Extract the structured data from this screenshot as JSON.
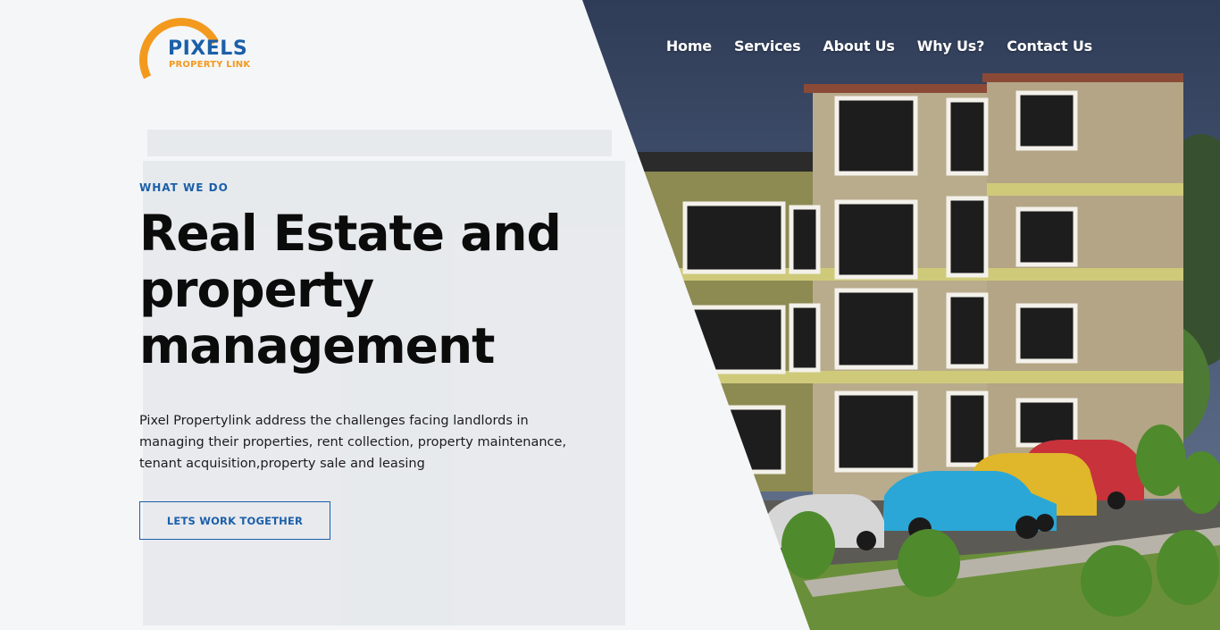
{
  "logo": {
    "word": "PIXELS",
    "sub": "PROPERTY LINK"
  },
  "nav": {
    "items": [
      "Home",
      "Services",
      "About Us",
      "Why Us?",
      "Contact Us"
    ]
  },
  "hero": {
    "eyebrow": "WHAT WE DO",
    "title_lines": [
      "Real Estate and",
      "property",
      "management"
    ],
    "description_lines": [
      "Pixel Propertylink address the challenges facing landlords in",
      "managing their properties, rent collection, property maintenance,",
      "tenant acquisition,property sale and leasing"
    ],
    "cta": "LETS WORK TOGETHER"
  },
  "colors": {
    "brand_blue": "#1b5fa8",
    "brand_orange": "#f39a1e",
    "sky": "#3e4e6a",
    "building_tan": "#b9ac8c",
    "building_yellow": "#cfca7a"
  }
}
